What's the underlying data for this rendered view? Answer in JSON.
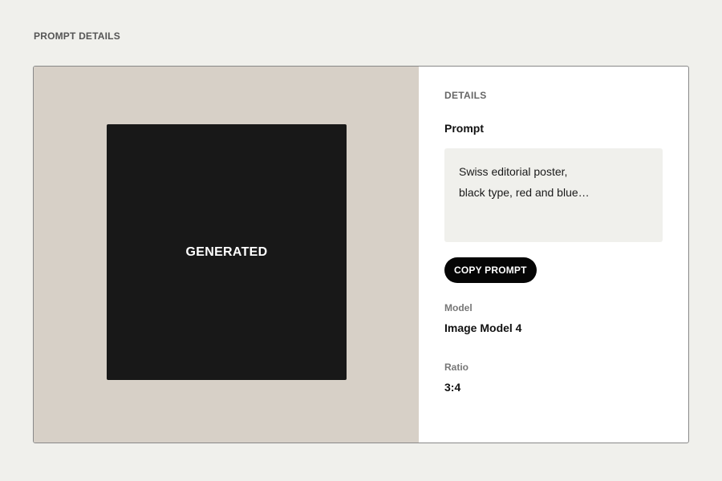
{
  "page": {
    "heading": "PROMPT DETAILS"
  },
  "preview": {
    "image_label": "GENERATED"
  },
  "details": {
    "section_label": "DETAILS",
    "prompt_heading": "Prompt",
    "prompt_lines": [
      "Swiss editorial poster,",
      "black type, red and blue…"
    ],
    "copy_button_label": "COPY PROMPT",
    "model_label": "Model",
    "model_value": "Image Model 4",
    "ratio_label": "Ratio",
    "ratio_value": "3:4"
  },
  "colors": {
    "page_background": "#f0f0ec",
    "preview_background": "#d7d0c7",
    "image_placeholder": "#181818",
    "button_background": "#050505"
  }
}
